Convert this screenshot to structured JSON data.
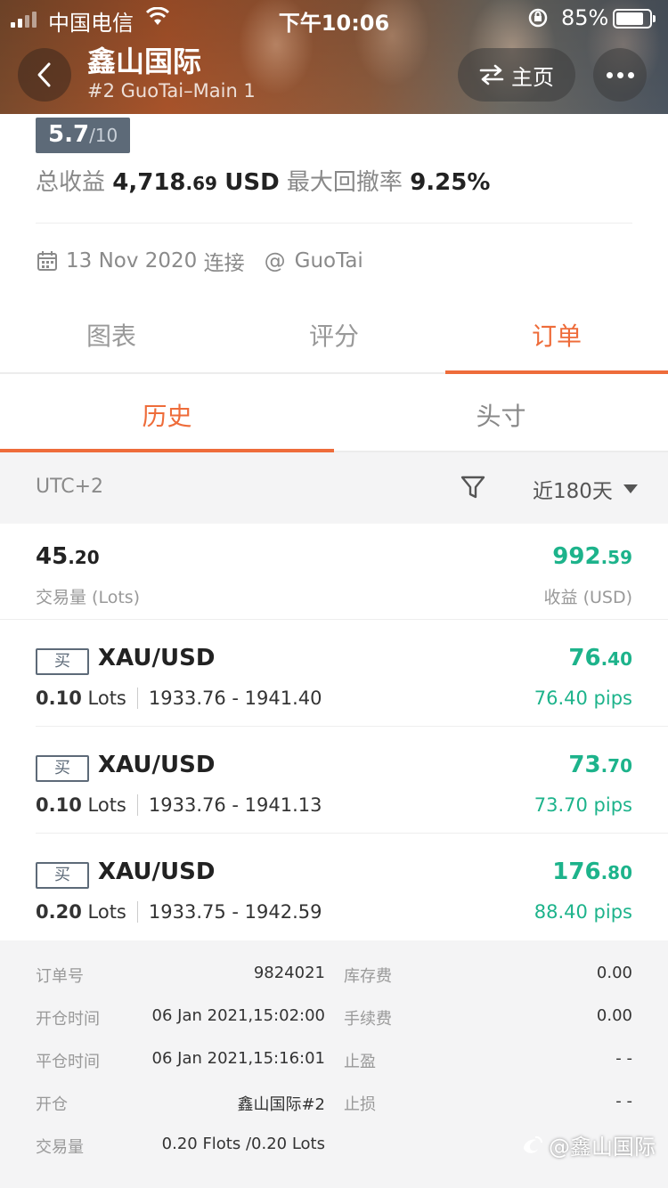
{
  "status_bar": {
    "carrier": "中国电信",
    "time": "下午10:06",
    "battery": "85%"
  },
  "header": {
    "title": "鑫山国际",
    "subtitle": "#2 GuoTai–Main 1",
    "home_label": "主页"
  },
  "summary": {
    "rating_score": "5.7",
    "rating_out_of": "/10",
    "total_profit_label": "总收益",
    "total_profit_int": "4,718",
    "total_profit_dec": ".69",
    "total_profit_unit": "USD",
    "drawdown_label": "最大回撤率",
    "drawdown_value": "9.25%",
    "connected_date": "13 Nov 2020",
    "connected_label": "连接",
    "broker": "GuoTai"
  },
  "tabs": [
    {
      "label": "图表",
      "active": false
    },
    {
      "label": "评分",
      "active": false
    },
    {
      "label": "订单",
      "active": true
    }
  ],
  "subtabs": [
    {
      "label": "历史",
      "active": true
    },
    {
      "label": "头寸",
      "active": false
    }
  ],
  "filter": {
    "timezone": "UTC+2",
    "period": "近180天"
  },
  "totals": {
    "lots_int": "45",
    "lots_dec": ".20",
    "lots_label": "交易量 (Lots)",
    "profit_int": "992",
    "profit_dec": ".59",
    "profit_label": "收益 (USD)"
  },
  "orders": [
    {
      "side": "买",
      "symbol": "XAU/USD",
      "lots": "0.10",
      "lots_unit": "Lots",
      "prices": "1933.76 - 1941.40",
      "profit_int": "76",
      "profit_dec": ".40",
      "pips": "76.40 pips"
    },
    {
      "side": "买",
      "symbol": "XAU/USD",
      "lots": "0.10",
      "lots_unit": "Lots",
      "prices": "1933.76 - 1941.13",
      "profit_int": "73",
      "profit_dec": ".70",
      "pips": "73.70 pips"
    },
    {
      "side": "买",
      "symbol": "XAU/USD",
      "lots": "0.20",
      "lots_unit": "Lots",
      "prices": "1933.75 - 1942.59",
      "profit_int": "176",
      "profit_dec": ".80",
      "pips": "88.40 pips"
    }
  ],
  "detail": {
    "rows": [
      {
        "k1": "订单号",
        "v1": "9824021",
        "k2": "库存费",
        "v2": "0.00"
      },
      {
        "k1": "开仓时间",
        "v1": "06 Jan 2021,15:02:00",
        "k2": "手续费",
        "v2": "0.00"
      },
      {
        "k1": "平仓时间",
        "v1": "06 Jan 2021,15:16:01",
        "k2": "止盈",
        "v2": "- -"
      },
      {
        "k1": "开仓",
        "v1": "鑫山国际#2",
        "k2": "止损",
        "v2": "- -"
      },
      {
        "k1": "交易量",
        "v1": "0.20 Flots /0.20 Lots",
        "k2": "",
        "v2": ""
      }
    ]
  },
  "watermark": "@鑫山国际",
  "colors": {
    "accent": "#ee6c3a",
    "profit": "#1db38b",
    "badge": "#5d6a78"
  }
}
